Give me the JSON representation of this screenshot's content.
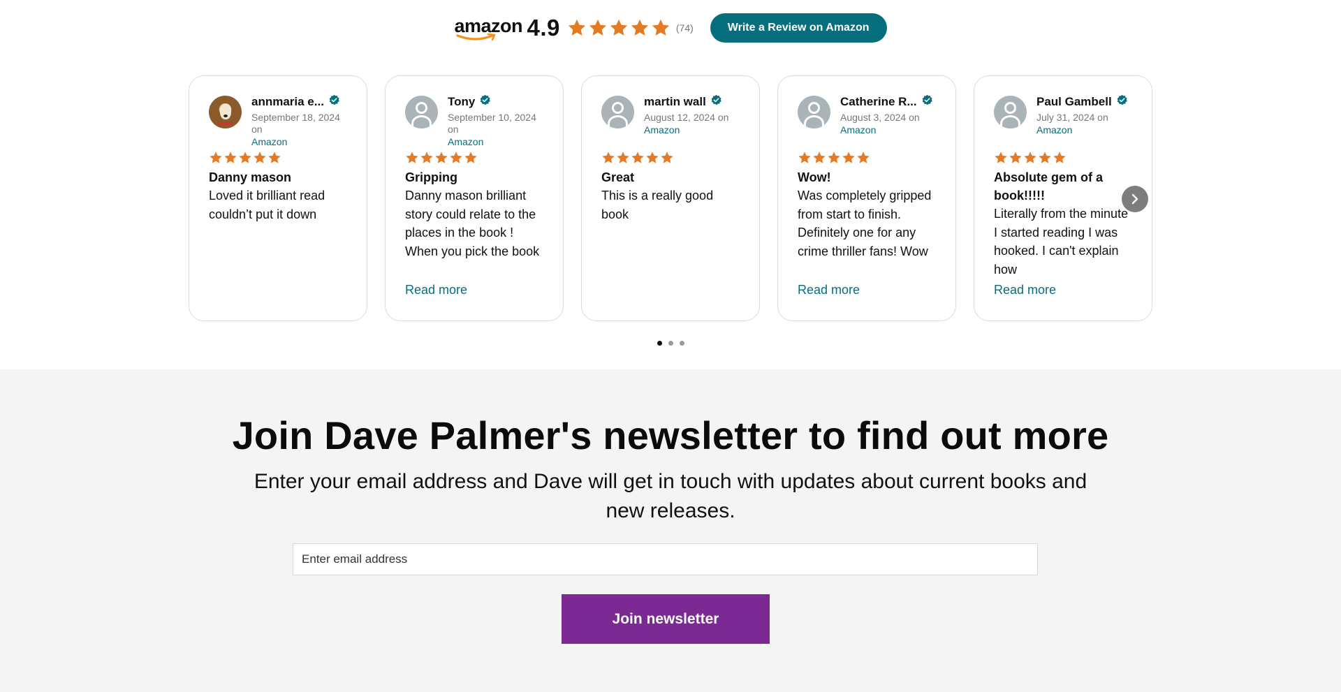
{
  "rating_bar": {
    "logo_text": "amazon",
    "score": "4.9",
    "stars": 5,
    "count": "(74)",
    "write_review_label": "Write a Review on Amazon"
  },
  "colors": {
    "star": "#e57a24",
    "accent_teal": "#076e7e",
    "newsletter_button": "#7a2a92",
    "newsletter_bg": "#f4f4f4"
  },
  "reviews": [
    {
      "name": "annmaria e...",
      "date": "September 18, 2024 on",
      "source": "Amazon",
      "rating": 5,
      "title": "Danny mason",
      "body": "Loved it brilliant read couldn’t put it down",
      "read_more": ""
    },
    {
      "name": "Tony",
      "date": "September 10, 2024 on",
      "source": "Amazon",
      "rating": 5,
      "title": "Gripping",
      "body": "Danny mason brilliant story could relate to the places in the book ! When you pick the book up it’s very hard",
      "read_more": "Read more"
    },
    {
      "name": "martin wall",
      "date": "August 12, 2024 on",
      "source": "Amazon",
      "rating": 5,
      "title": "Great",
      "body": "This is a really good book",
      "read_more": ""
    },
    {
      "name": "Catherine R...",
      "date": "August 3, 2024 on",
      "source": "Amazon",
      "rating": 5,
      "title": "Wow!",
      "body": "Was completely gripped from start to finish. Definitely one for any crime thriller fans! Wow wow wow.",
      "read_more": "Read more"
    },
    {
      "name": "Paul Gambell",
      "date": "July 31, 2024 on",
      "source": "Amazon",
      "rating": 5,
      "title": "Absolute gem of a book!!!!!",
      "body": "Literally from the minute I started reading I was hooked. I can't explain how",
      "read_more": "Read more"
    }
  ],
  "carousel": {
    "pages": 3,
    "active_page": 1
  },
  "newsletter": {
    "title": "Join Dave Palmer's newsletter to find out more",
    "subtitle": "Enter your email address and Dave will get in touch with updates about current books and new releases.",
    "email_placeholder": "Enter email address",
    "button_label": "Join newsletter"
  }
}
